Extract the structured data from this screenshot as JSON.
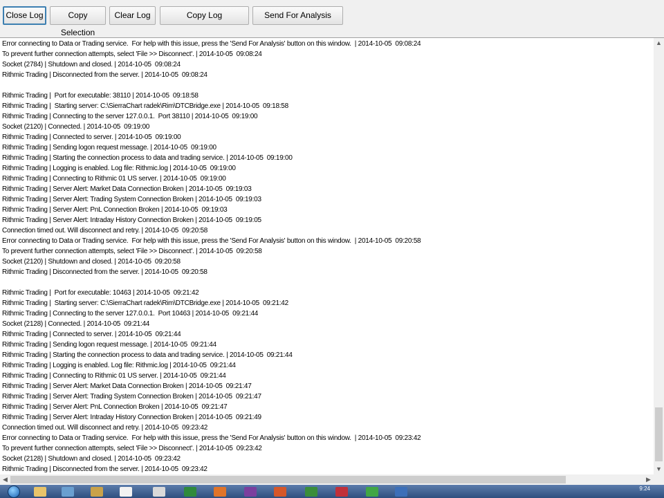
{
  "toolbar": {
    "buttons": [
      {
        "label": "Close Log"
      },
      {
        "label": "Copy Selection"
      },
      {
        "label": "Clear Log"
      },
      {
        "label": "Copy Log"
      },
      {
        "label": "Send For Analysis"
      }
    ]
  },
  "log": {
    "lines": [
      "Error connecting to Data or Trading service.  For help with this issue, press the 'Send For Analysis' button on this window.  | 2014-10-05  09:08:24",
      "To prevent further connection attempts, select 'File >> Disconnect'. | 2014-10-05  09:08:24",
      "Socket (2784) | Shutdown and closed. | 2014-10-05  09:08:24",
      "Rithmic Trading | Disconnected from the server. | 2014-10-05  09:08:24",
      "",
      "Rithmic Trading |  Port for executable: 38110 | 2014-10-05  09:18:58",
      "Rithmic Trading |  Starting server: C:\\SierraChart radek\\Rim\\DTCBridge.exe | 2014-10-05  09:18:58",
      "Rithmic Trading | Connecting to the server 127.0.0.1.  Port 38110 | 2014-10-05  09:19:00",
      "Socket (2120) | Connected. | 2014-10-05  09:19:00",
      "Rithmic Trading | Connected to server. | 2014-10-05  09:19:00",
      "Rithmic Trading | Sending logon request message. | 2014-10-05  09:19:00",
      "Rithmic Trading | Starting the connection process to data and trading service. | 2014-10-05  09:19:00",
      "Rithmic Trading | Logging is enabled. Log file: Rithmic.log | 2014-10-05  09:19:00",
      "Rithmic Trading | Connecting to Rithmic 01 US server. | 2014-10-05  09:19:00",
      "Rithmic Trading | Server Alert: Market Data Connection Broken | 2014-10-05  09:19:03",
      "Rithmic Trading | Server Alert: Trading System Connection Broken | 2014-10-05  09:19:03",
      "Rithmic Trading | Server Alert: PnL Connection Broken | 2014-10-05  09:19:03",
      "Rithmic Trading | Server Alert: Intraday History Connection Broken | 2014-10-05  09:19:05",
      "Connection timed out. Will disconnect and retry. | 2014-10-05  09:20:58",
      "Error connecting to Data or Trading service.  For help with this issue, press the 'Send For Analysis' button on this window.  | 2014-10-05  09:20:58",
      "To prevent further connection attempts, select 'File >> Disconnect'. | 2014-10-05  09:20:58",
      "Socket (2120) | Shutdown and closed. | 2014-10-05  09:20:58",
      "Rithmic Trading | Disconnected from the server. | 2014-10-05  09:20:58",
      "",
      "Rithmic Trading |  Port for executable: 10463 | 2014-10-05  09:21:42",
      "Rithmic Trading |  Starting server: C:\\SierraChart radek\\Rim\\DTCBridge.exe | 2014-10-05  09:21:42",
      "Rithmic Trading | Connecting to the server 127.0.0.1.  Port 10463 | 2014-10-05  09:21:44",
      "Socket (2128) | Connected. | 2014-10-05  09:21:44",
      "Rithmic Trading | Connected to server. | 2014-10-05  09:21:44",
      "Rithmic Trading | Sending logon request message. | 2014-10-05  09:21:44",
      "Rithmic Trading | Starting the connection process to data and trading service. | 2014-10-05  09:21:44",
      "Rithmic Trading | Logging is enabled. Log file: Rithmic.log | 2014-10-05  09:21:44",
      "Rithmic Trading | Connecting to Rithmic 01 US server. | 2014-10-05  09:21:44",
      "Rithmic Trading | Server Alert: Market Data Connection Broken | 2014-10-05  09:21:47",
      "Rithmic Trading | Server Alert: Trading System Connection Broken | 2014-10-05  09:21:47",
      "Rithmic Trading | Server Alert: PnL Connection Broken | 2014-10-05  09:21:47",
      "Rithmic Trading | Server Alert: Intraday History Connection Broken | 2014-10-05  09:21:49",
      "Connection timed out. Will disconnect and retry. | 2014-10-05  09:23:42",
      "Error connecting to Data or Trading service.  For help with this issue, press the 'Send For Analysis' button on this window.  | 2014-10-05  09:23:42",
      "To prevent further connection attempts, select 'File >> Disconnect'. | 2014-10-05  09:23:42",
      "Socket (2128) | Shutdown and closed. | 2014-10-05  09:23:42",
      "Rithmic Trading | Disconnected from the server. | 2014-10-05  09:23:42"
    ]
  },
  "scrollbars": {
    "up_icon": "chevron-up-icon",
    "down_icon": "chevron-down-icon",
    "left_icon": "chevron-left-icon",
    "right_icon": "chevron-right-icon"
  },
  "taskbar": {
    "clock": "9:24",
    "items": [
      {
        "icon": "start-orb-icon",
        "color": "#1a5fb0"
      },
      {
        "icon": "file-explorer-icon",
        "color": "#e8c46a"
      },
      {
        "icon": "tool-icon",
        "color": "#6a9fd0"
      },
      {
        "icon": "media-icon",
        "color": "#c9a24a"
      },
      {
        "icon": "notes-icon",
        "color": "#f2f2f2"
      },
      {
        "icon": "app-icon",
        "color": "#d9d9d9"
      },
      {
        "icon": "excel-icon",
        "color": "#2f8a3c"
      },
      {
        "icon": "firefox-icon",
        "color": "#e0742a"
      },
      {
        "icon": "onenote-icon",
        "color": "#7b3f9e"
      },
      {
        "icon": "powerpoint-icon",
        "color": "#d5572a"
      },
      {
        "icon": "network-icon",
        "color": "#3a8d3a"
      },
      {
        "icon": "record-icon",
        "color": "#c0303a"
      },
      {
        "icon": "upload-icon",
        "color": "#41a645"
      },
      {
        "icon": "globe-icon",
        "color": "#3c6fb8"
      }
    ]
  }
}
